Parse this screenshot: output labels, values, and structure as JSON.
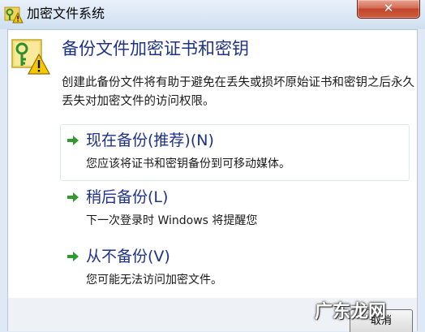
{
  "window": {
    "title": "加密文件系统",
    "close_glyph": "✕"
  },
  "content": {
    "heading": "备份文件加密证书和密钥",
    "description": "创建此备份文件将有助于避免在丢失或损坏原始证书和密钥之后永久丢失对加密文件的访问权限。"
  },
  "options": [
    {
      "title": "现在备份(推荐)(N)",
      "description": "您应该将证书和密钥备份到可移动媒体。",
      "selected": true
    },
    {
      "title": "稍后备份(L)",
      "description": "下一次登录时 Windows 将提醒您"
    },
    {
      "title": "从不备份(V)",
      "description": "您可能无法访问加密文件。"
    }
  ],
  "footer": {
    "cancel_label": "取消"
  },
  "watermark": "广东龙网",
  "colors": {
    "heading_blue": "#1e3287",
    "arrow_green": "#2e9b2e",
    "close_red": "#c2462c"
  },
  "icons": {
    "title": "key-warning-icon",
    "main": "key-certificate-warning-icon",
    "option_arrow": "green-arrow-icon"
  }
}
